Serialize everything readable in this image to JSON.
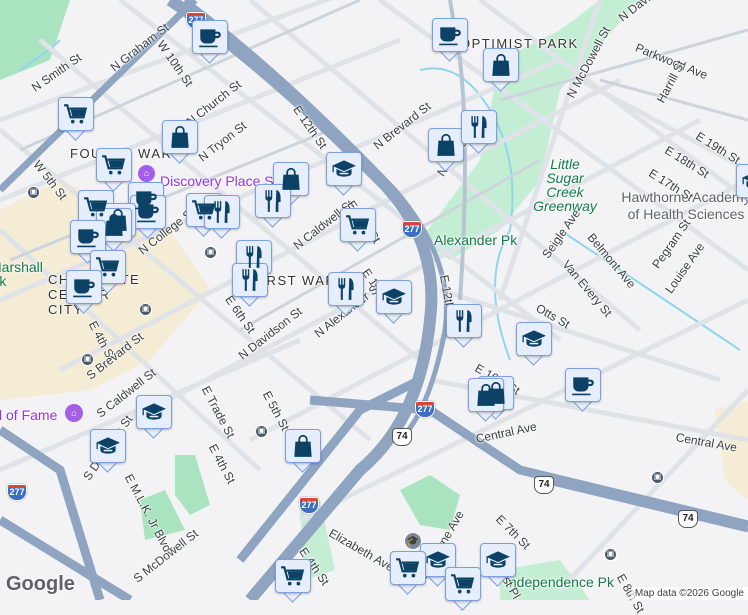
{
  "map": {
    "neighborhoods": [
      "FOURTH WARD",
      "FIRST WARD",
      "OPTIMIST PARK",
      "CHARLOTTE CENTER CITY"
    ],
    "parks": [
      "Little Sugar Creek Greenway",
      "Alexander Pk",
      "Independence Pk",
      "Marshall Pk"
    ],
    "pois": [
      "Discovery Place S",
      "Hall of Fame"
    ],
    "schools": [
      "Hawthorne Academy of Health Sciences"
    ],
    "streets": [
      "N Graham St",
      "W 10th St",
      "N Smith St",
      "N Church St",
      "N Tryon St",
      "W 5th St",
      "N College St",
      "E 12th St",
      "N Brevard St",
      "N Caldwell St",
      "E 11th St",
      "E 10th St",
      "E 6th St",
      "N Davidson St",
      "N Alexander St",
      "N Davidson St",
      "Parkwood Ave",
      "N McDowell St",
      "Harrill St",
      "E 19th St",
      "E 18th St",
      "E 17th St",
      "Seigle Ave",
      "Belmont Ave",
      "Van Every St",
      "Pegram St",
      "Louise Ave",
      "Otts St",
      "E 12th St",
      "E 10th St",
      "Central Ave",
      "Central Ave",
      "E 4th St",
      "S Brevard St",
      "S Caldwell St",
      "S Davidson St",
      "E M.L.K. Jr Blvd",
      "E Trade St",
      "E 5th St",
      "E 4th St",
      "S McDowell St",
      "Elizabeth Ave",
      "E 4th St",
      "E 7th St",
      "Hawthorne Ave",
      "Amherst Pl",
      "E 8th St",
      "N Davidson St"
    ],
    "highway_shields": {
      "interstate": "277",
      "us_route": "74"
    },
    "google_logo": "Google",
    "attribution": "Map data ©2026 Google"
  }
}
